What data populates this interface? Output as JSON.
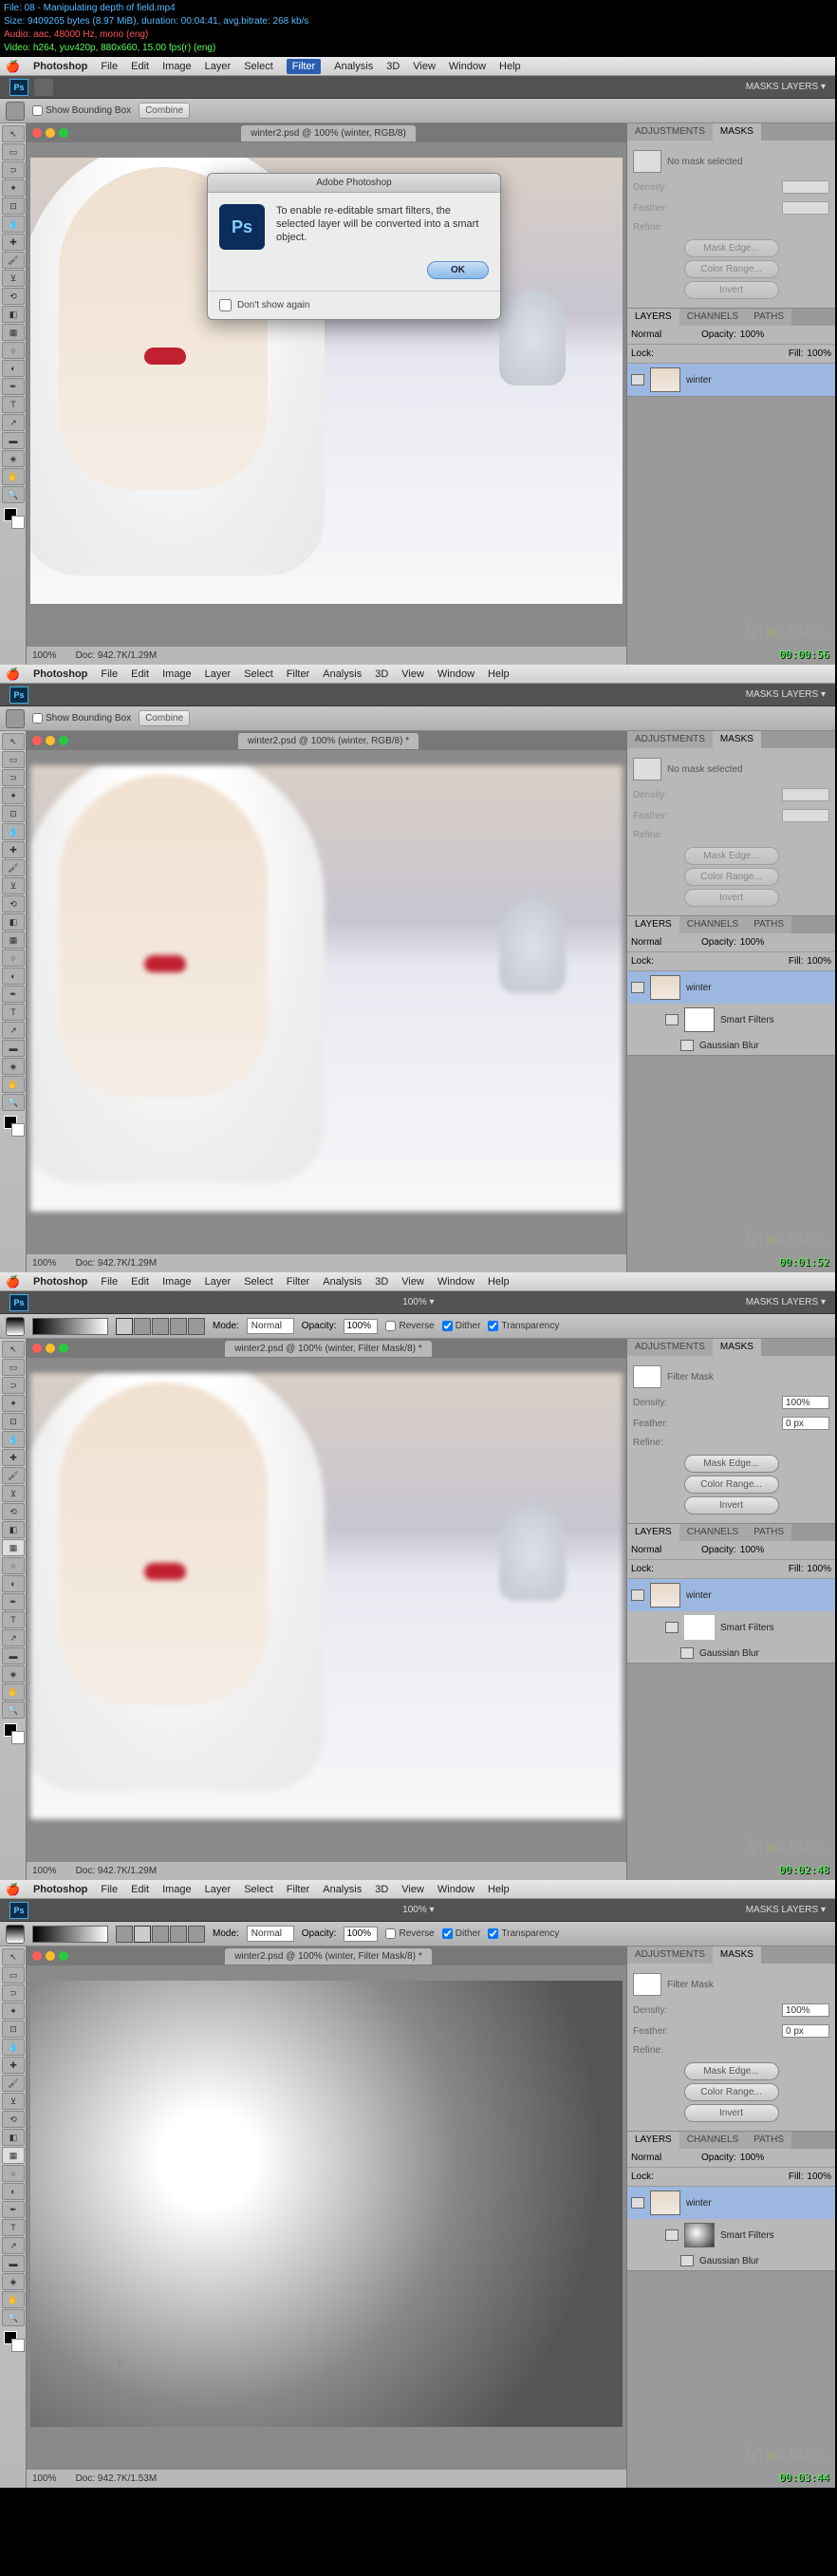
{
  "meta": {
    "file": "File: 08 - Manipulating depth of field.mp4",
    "size": "Size: 9409265 bytes (8.97 MiB), duration: 00:04:41, avg.bitrate: 268 kb/s",
    "audio": "Audio: aac, 48000 Hz, mono (eng)",
    "video": "Video: h264, yuv420p, 880x660, 15.00 fps(r) (eng)"
  },
  "menu": {
    "app": "Photoshop",
    "items": [
      "File",
      "Edit",
      "Image",
      "Layer",
      "Select",
      "Filter",
      "Analysis",
      "3D",
      "View",
      "Window",
      "Help"
    ]
  },
  "appbar": {
    "label": "MASKS LAYERS ▾"
  },
  "screen1": {
    "optbar": {
      "chk": "Show Bounding Box",
      "combine": "Combine"
    },
    "tab": "winter2.psd @ 100% (winter, RGB/8)",
    "dialog": {
      "title": "Adobe Photoshop",
      "text": "To enable re-editable smart filters, the selected layer will be converted into a smart object.",
      "ok": "OK",
      "dontshow": "Don't show again"
    },
    "mask": {
      "label": "No mask selected",
      "density": "Density:",
      "feather": "Feather:",
      "refine": "Refine:",
      "me": "Mask Edge...",
      "cr": "Color Range...",
      "inv": "Invert"
    },
    "layers": {
      "tabs": [
        "LAYERS",
        "CHANNELS",
        "PATHS"
      ],
      "mode": "Normal",
      "opl": "Opacity:",
      "op": "100%",
      "lockl": "Lock:",
      "filll": "Fill:",
      "fill": "100%",
      "layer": "winter"
    },
    "status": {
      "zoom": "100%",
      "doc": "Doc: 942.7K/1.29M"
    },
    "watermark": "lynda.com",
    "ts": "00:00:56"
  },
  "screen2": {
    "tab": "winter2.psd @ 100% (winter, RGB/8) *",
    "layers": {
      "layer": "winter",
      "sf": "Smart Filters",
      "gb": "Gaussian Blur"
    },
    "ts": "00:01:52"
  },
  "screen3": {
    "optbar": {
      "hun": "100% ▾",
      "mode": "Mode:",
      "normal": "Normal",
      "opl": "Opacity:",
      "op": "100%",
      "rev": "Reverse",
      "dith": "Dither",
      "trans": "Transparency"
    },
    "tab": "winter2.psd @ 100% (winter, Filter Mask/8) *",
    "mask": {
      "label": "Filter Mask",
      "density": "Density:",
      "dval": "100%",
      "feather": "Feather:",
      "fval": "0 px",
      "refine": "Refine:"
    },
    "ts": "00:02:48"
  },
  "screen4": {
    "tab": "winter2.psd @ 100% (winter, Filter Mask/8) *",
    "status": {
      "zoom": "100%",
      "doc": "Doc: 942.7K/1.53M"
    },
    "ts": "00:03:44"
  },
  "adj": "ADJUSTMENTS",
  "masks": "MASKS"
}
